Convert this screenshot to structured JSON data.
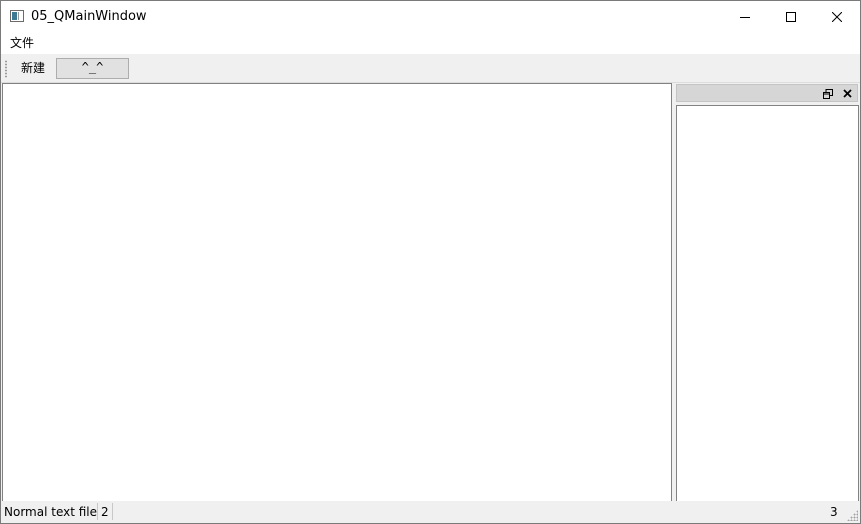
{
  "window": {
    "title": "05_QMainWindow",
    "icon": "app-window-icon",
    "controls": {
      "minimize": "minimize-icon",
      "maximize": "maximize-icon",
      "close": "close-icon"
    }
  },
  "menubar": {
    "items": [
      {
        "label": "文件"
      }
    ]
  },
  "toolbar": {
    "items": [
      {
        "label": "新建"
      },
      {
        "label": "^_^"
      }
    ]
  },
  "dock": {
    "title": "",
    "float_icon": "float-icon",
    "close_icon": "close-icon"
  },
  "statusbar": {
    "message": "Normal text file",
    "left_widget": "2",
    "right_widget": "3"
  },
  "colors": {
    "titlebar_bg": "#ffffff",
    "window_bg": "#f0f0f0",
    "dock_title_bg": "#d6d6d6",
    "border": "#828282"
  }
}
